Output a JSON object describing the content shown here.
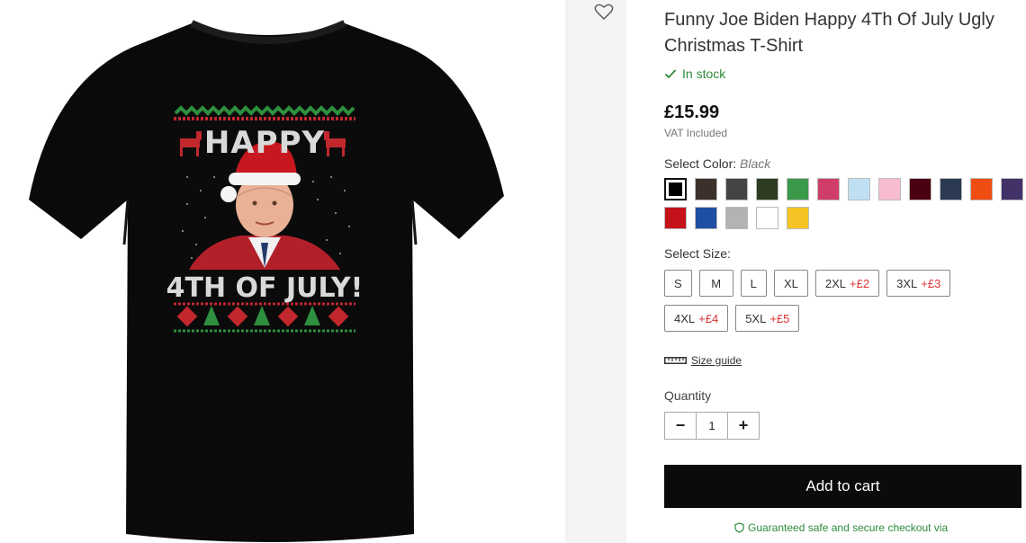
{
  "product": {
    "title": "Funny Joe Biden Happy 4Th Of July Ugly Christmas T-Shirt",
    "stock": "In stock",
    "price": "£15.99",
    "vat": "VAT Included",
    "shirt_print": {
      "top_text": "HAPPY",
      "bottom_text": "4TH OF JULY!"
    }
  },
  "color": {
    "label": "Select Color:",
    "selected": "Black",
    "swatches": [
      "#000000",
      "#3b302a",
      "#444444",
      "#2c3b21",
      "#3a9a4a",
      "#cf3d68",
      "#bfe0f2",
      "#f8bcd2",
      "#4a0212",
      "#2b3a52",
      "#f04d12",
      "#433268",
      "#c4111a",
      "#1f4fa4",
      "#b3b3b3",
      "#ffffff",
      "#f6c324"
    ]
  },
  "size": {
    "label": "Select Size:",
    "options": [
      {
        "name": "S",
        "extra": ""
      },
      {
        "name": "M",
        "extra": ""
      },
      {
        "name": "L",
        "extra": ""
      },
      {
        "name": "XL",
        "extra": ""
      },
      {
        "name": "2XL",
        "extra": "+£2"
      },
      {
        "name": "3XL",
        "extra": "+£3"
      },
      {
        "name": "4XL",
        "extra": "+£4"
      },
      {
        "name": "5XL",
        "extra": "+£5"
      }
    ]
  },
  "size_guide": "Size guide",
  "quantity": {
    "label": "Quantity",
    "value": "1",
    "minus": "−",
    "plus": "+"
  },
  "add_to_cart": "Add to cart",
  "secure_text": "Guaranteed safe and secure checkout via",
  "icons": {
    "wishlist": "heart-outline-icon",
    "stock": "check-icon",
    "size_guide": "ruler-icon",
    "secure": "shield-icon"
  }
}
